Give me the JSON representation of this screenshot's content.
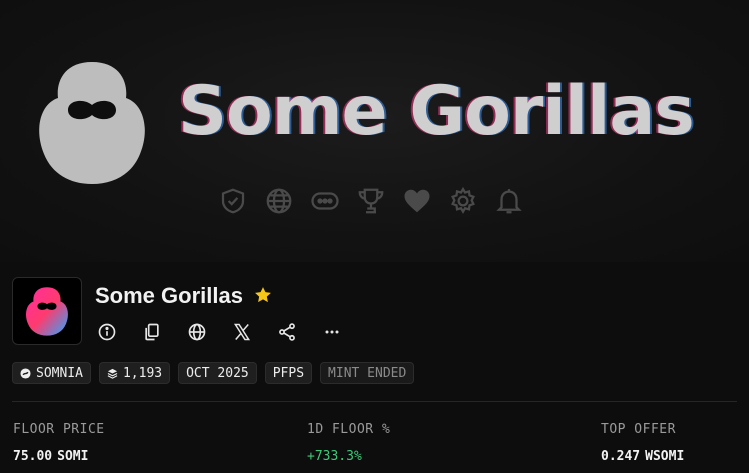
{
  "banner": {
    "title": "Some Gorillas",
    "icons": [
      "shield-check-icon",
      "globe-icon",
      "chat-icon",
      "trophy-icon",
      "heart-icon",
      "gear-icon",
      "bell-icon"
    ]
  },
  "collection": {
    "name": "Some Gorillas",
    "favorite": true,
    "actions": [
      "info-icon",
      "copy-icon",
      "globe-icon",
      "x-logo-icon",
      "share-icon",
      "more-icon"
    ]
  },
  "tags": {
    "chain": "SOMNIA",
    "supply": "1,193",
    "date": "OCT 2025",
    "category": "PFPS",
    "status": "MINT ENDED"
  },
  "stats": {
    "floor_price": {
      "label": "FLOOR PRICE",
      "value": "75.00",
      "unit": "SOMI"
    },
    "floor_change": {
      "label": "1D FLOOR %",
      "value": "+733.3%"
    },
    "top_offer": {
      "label": "TOP OFFER",
      "value": "0.247",
      "unit": "WSOMI"
    }
  },
  "colors": {
    "background": "#0d0d0d",
    "positive": "#3ec97a",
    "star": "#f5c518",
    "avatar_gradient": [
      "#ff2fa0",
      "#7a3cff",
      "#2aa8ff"
    ]
  }
}
